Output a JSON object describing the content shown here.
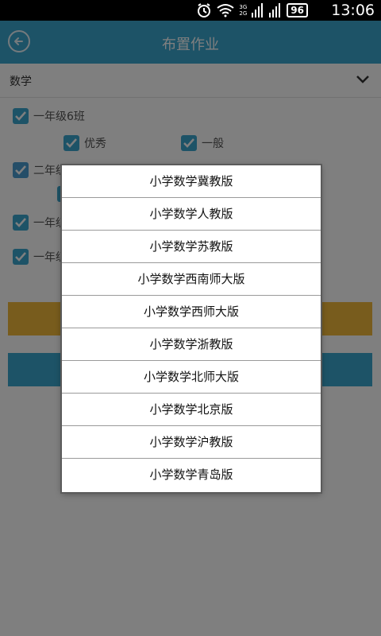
{
  "status_bar": {
    "time": "13:06",
    "battery": "96",
    "network_top": "3G",
    "network_bottom": "2G"
  },
  "header": {
    "title": "布置作业",
    "back_icon": "back-arrow-circle-icon"
  },
  "subject": {
    "selected": "数学"
  },
  "classes": [
    {
      "label": "一年级6班",
      "checked": true,
      "sub": [
        {
          "label": "优秀",
          "checked": true
        },
        {
          "label": "一般",
          "checked": true
        }
      ]
    },
    {
      "label": "二年级",
      "checked": true
    },
    {
      "label": "一年级",
      "checked": true
    },
    {
      "label": "一年级",
      "checked": true
    }
  ],
  "colors": {
    "accent": "#3ba6cf",
    "warning": "#f0b93a",
    "overlay": "rgba(0,0,0,0.5)"
  },
  "dialog": {
    "options": [
      "小学数学冀教版",
      "小学数学人教版",
      "小学数学苏教版",
      "小学数学西南师大版",
      "小学数学西师大版",
      "小学数学浙教版",
      "小学数学北师大版",
      "小学数学北京版",
      "小学数学沪教版",
      "小学数学青岛版"
    ]
  }
}
